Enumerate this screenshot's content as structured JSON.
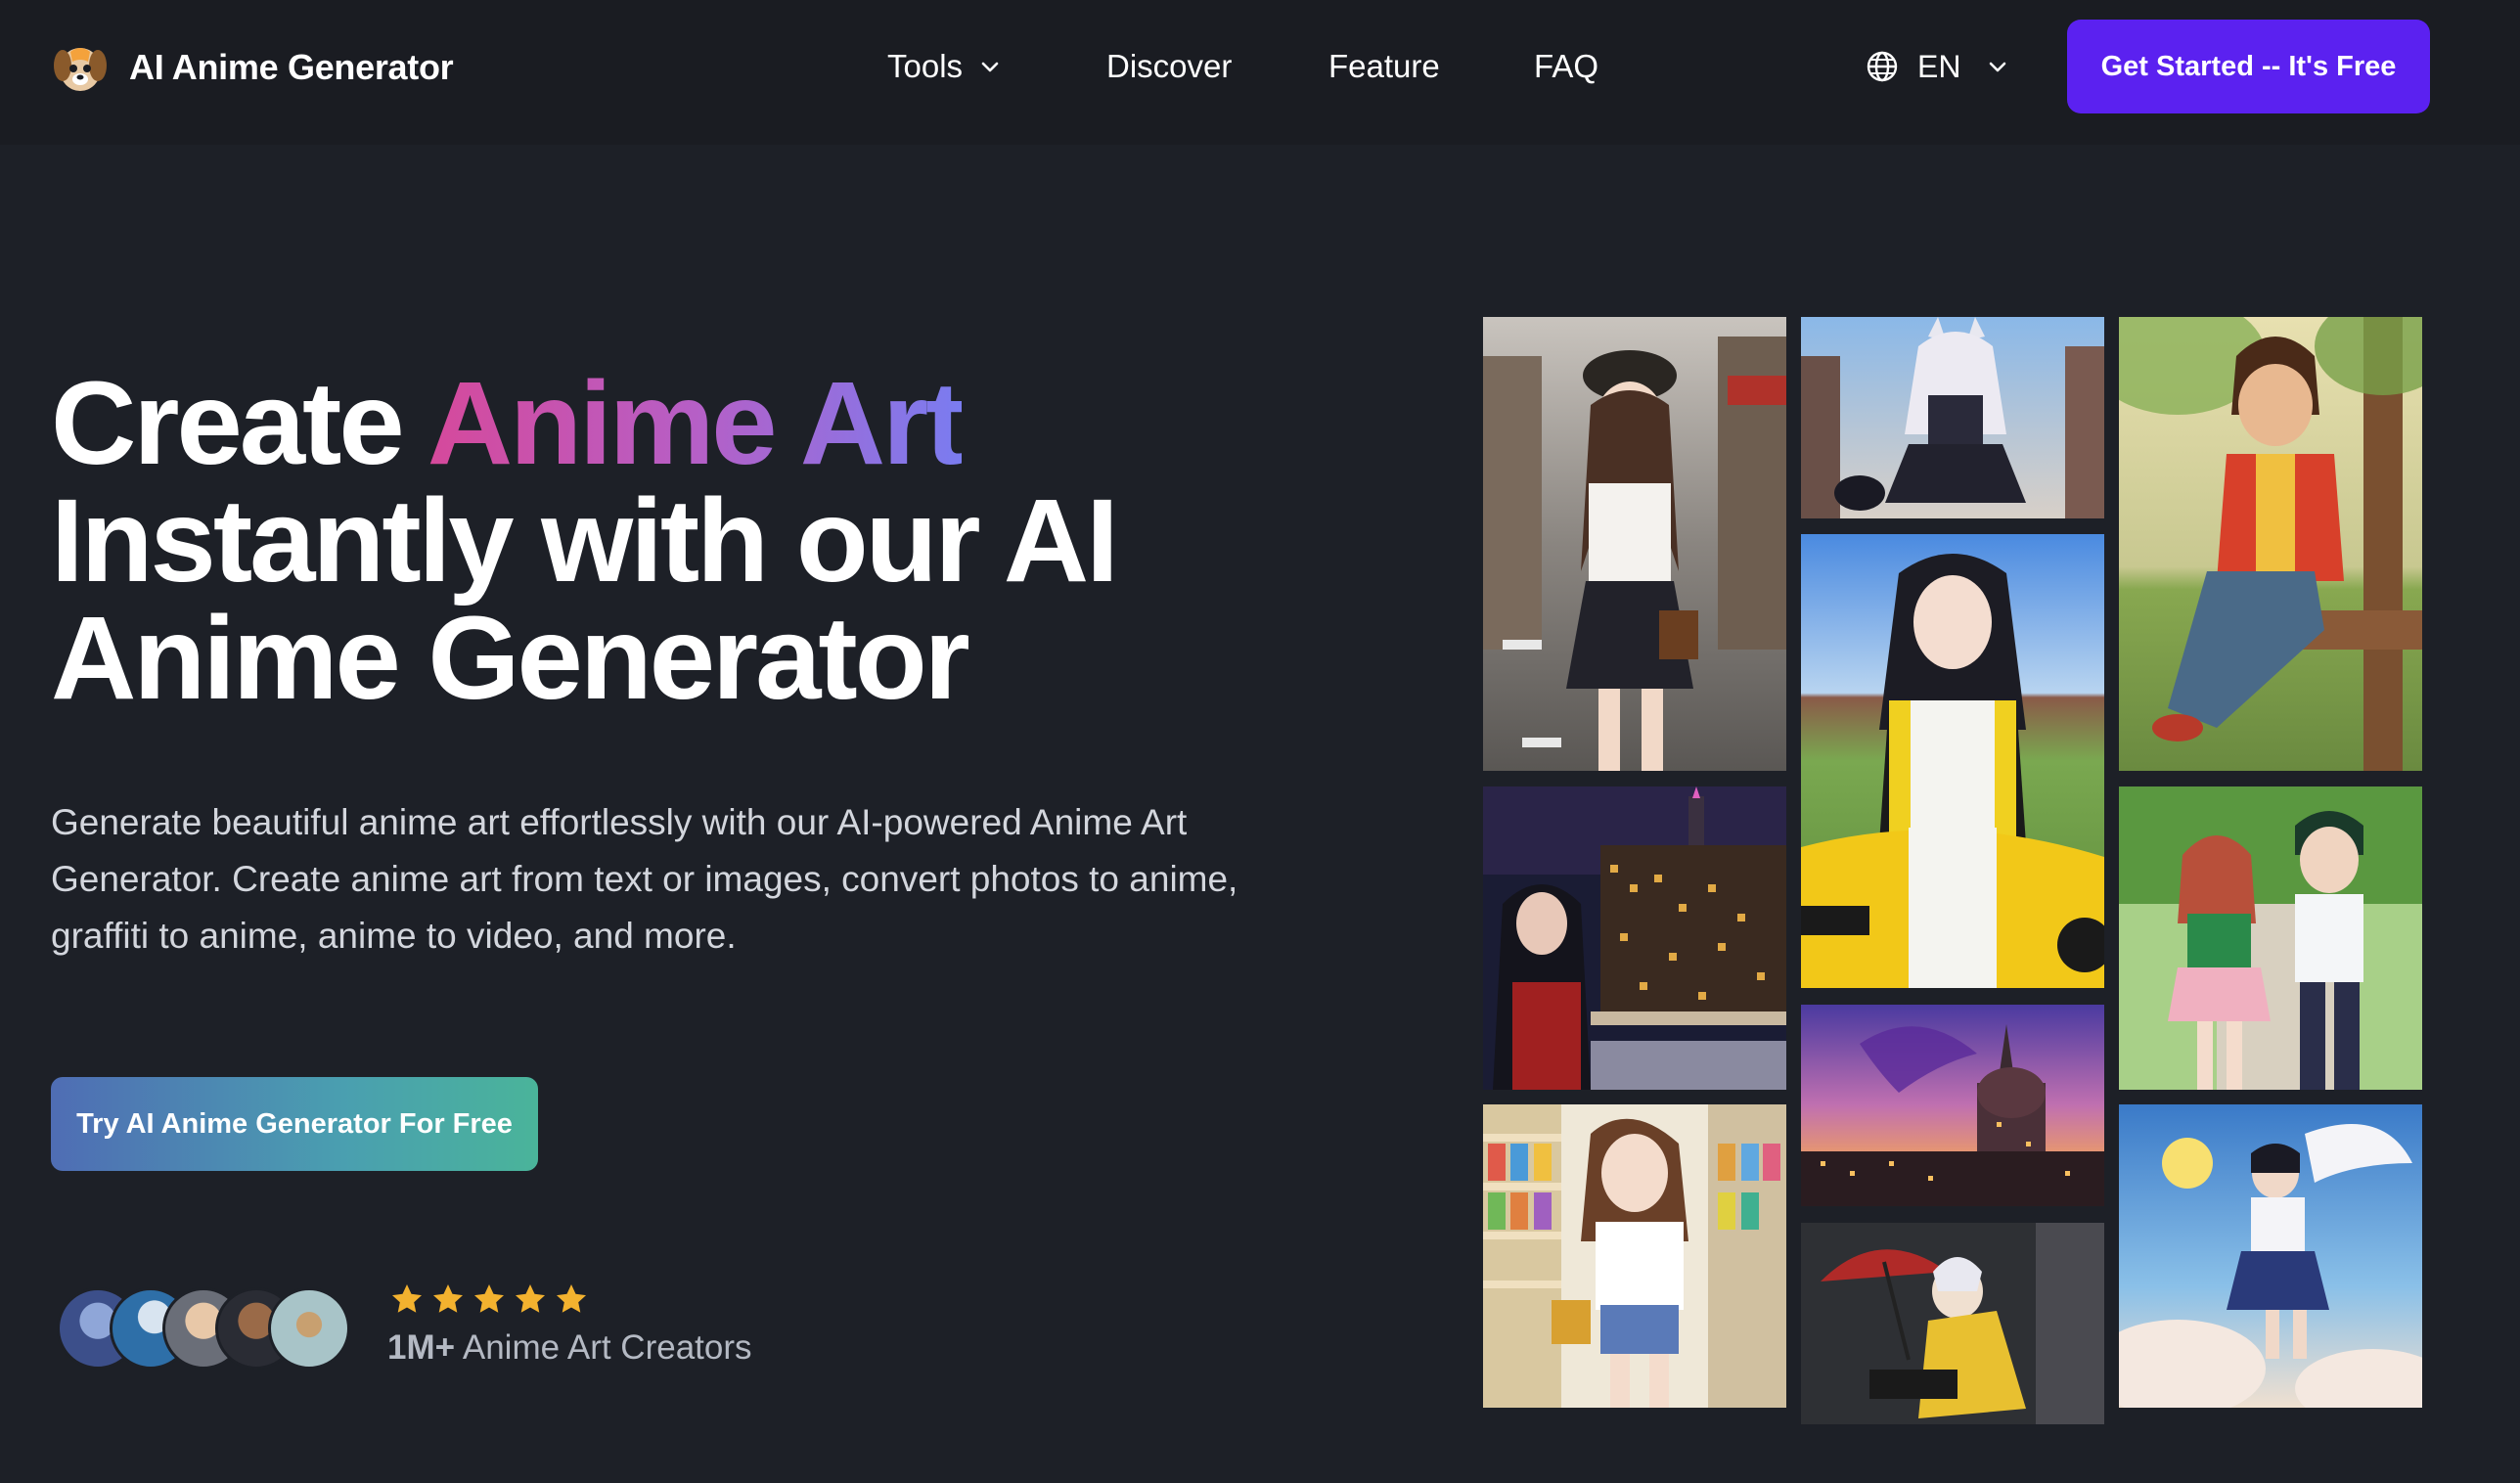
{
  "nav": {
    "brand_name": "AI Anime Generator",
    "logo_icon": "dog-logo-icon",
    "links": [
      {
        "label": "Tools",
        "has_dropdown": true
      },
      {
        "label": "Discover",
        "has_dropdown": false
      },
      {
        "label": "Feature",
        "has_dropdown": false
      },
      {
        "label": "FAQ",
        "has_dropdown": false
      }
    ],
    "language": {
      "icon": "globe-icon",
      "code": "EN"
    },
    "cta_label": "Get Started -- It's Free"
  },
  "hero": {
    "headline_prefix": "Create ",
    "headline_highlight": "Anime Art",
    "headline_line2": "Instantly with our AI",
    "headline_line3": "Anime Generator",
    "subtitle": "Generate beautiful anime art effortlessly with our AI-powered Anime Art Generator. Create anime art from text or images, convert photos to anime, graffiti to anime, anime to video, and more.",
    "cta_label": "Try AI Anime Generator For Free",
    "rating_stars": 5,
    "creators_count": "1M+",
    "creators_label": " Anime Art Creators"
  },
  "colors": {
    "background": "#1d2027",
    "nav_background": "#1a1c22",
    "accent_purple": "#5b21f0",
    "gradient_pink": "#d6499b",
    "gradient_blue": "#7a7cf0",
    "star": "#f3b22f"
  },
  "gallery": [
    {
      "name": "street-girl-image"
    },
    {
      "name": "catgirl-maid-image"
    },
    {
      "name": "boy-in-park-image"
    },
    {
      "name": "racer-girl-image"
    },
    {
      "name": "city-night-girl-image"
    },
    {
      "name": "couple-walking-image"
    },
    {
      "name": "fantasy-cathedral-image"
    },
    {
      "name": "supermarket-girl-image"
    },
    {
      "name": "umbrella-boy-image"
    },
    {
      "name": "flying-girl-image"
    }
  ]
}
